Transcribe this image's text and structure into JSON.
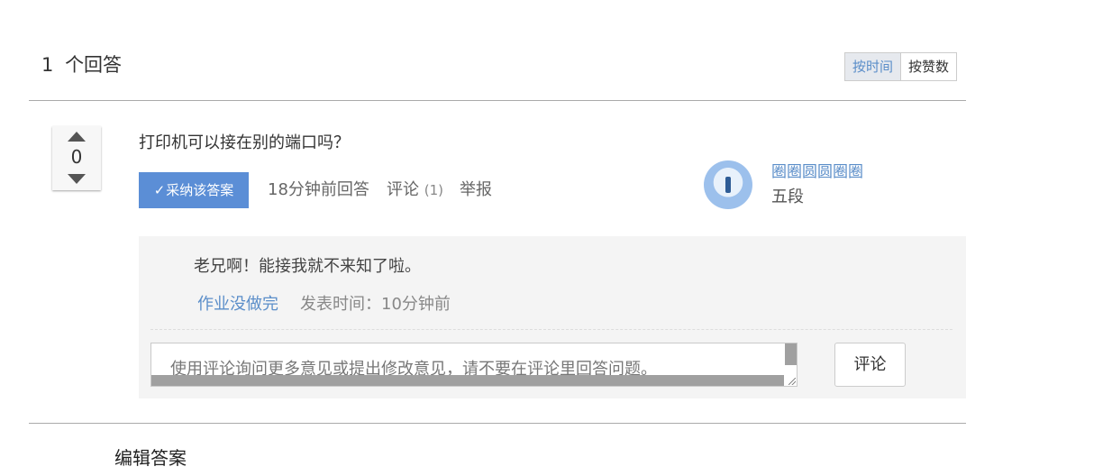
{
  "header": {
    "answer_count": "1",
    "answer_count_suffix": "个回答",
    "sort_options": [
      "按时间",
      "按赞数"
    ],
    "active_sort": "按时间"
  },
  "answer": {
    "votes": "0",
    "text": "打印机可以接在别的端口吗？",
    "accept_label": "采纳该答案",
    "time_label": "18分钟前回答",
    "comment_label": "评论",
    "comment_count": "(1)",
    "report_label": "举报",
    "author": {
      "name": "圈圈圆圆圈圈",
      "rank": "五段"
    }
  },
  "comments": {
    "items": [
      {
        "text": "老兄啊！能接我就不来知了啦。",
        "author": "作业没做完",
        "time_label": "发表时间：10分钟前"
      }
    ],
    "input_placeholder": "使用评论询问更多意见或提出修改意见，请不要在评论里回答问题。",
    "submit_label": "评论"
  },
  "editor": {
    "title": "编辑答案"
  },
  "colors": {
    "accent": "#5b8ec9",
    "accept_button": "#5b8ed6",
    "comment_bg": "#f4f4f4"
  }
}
